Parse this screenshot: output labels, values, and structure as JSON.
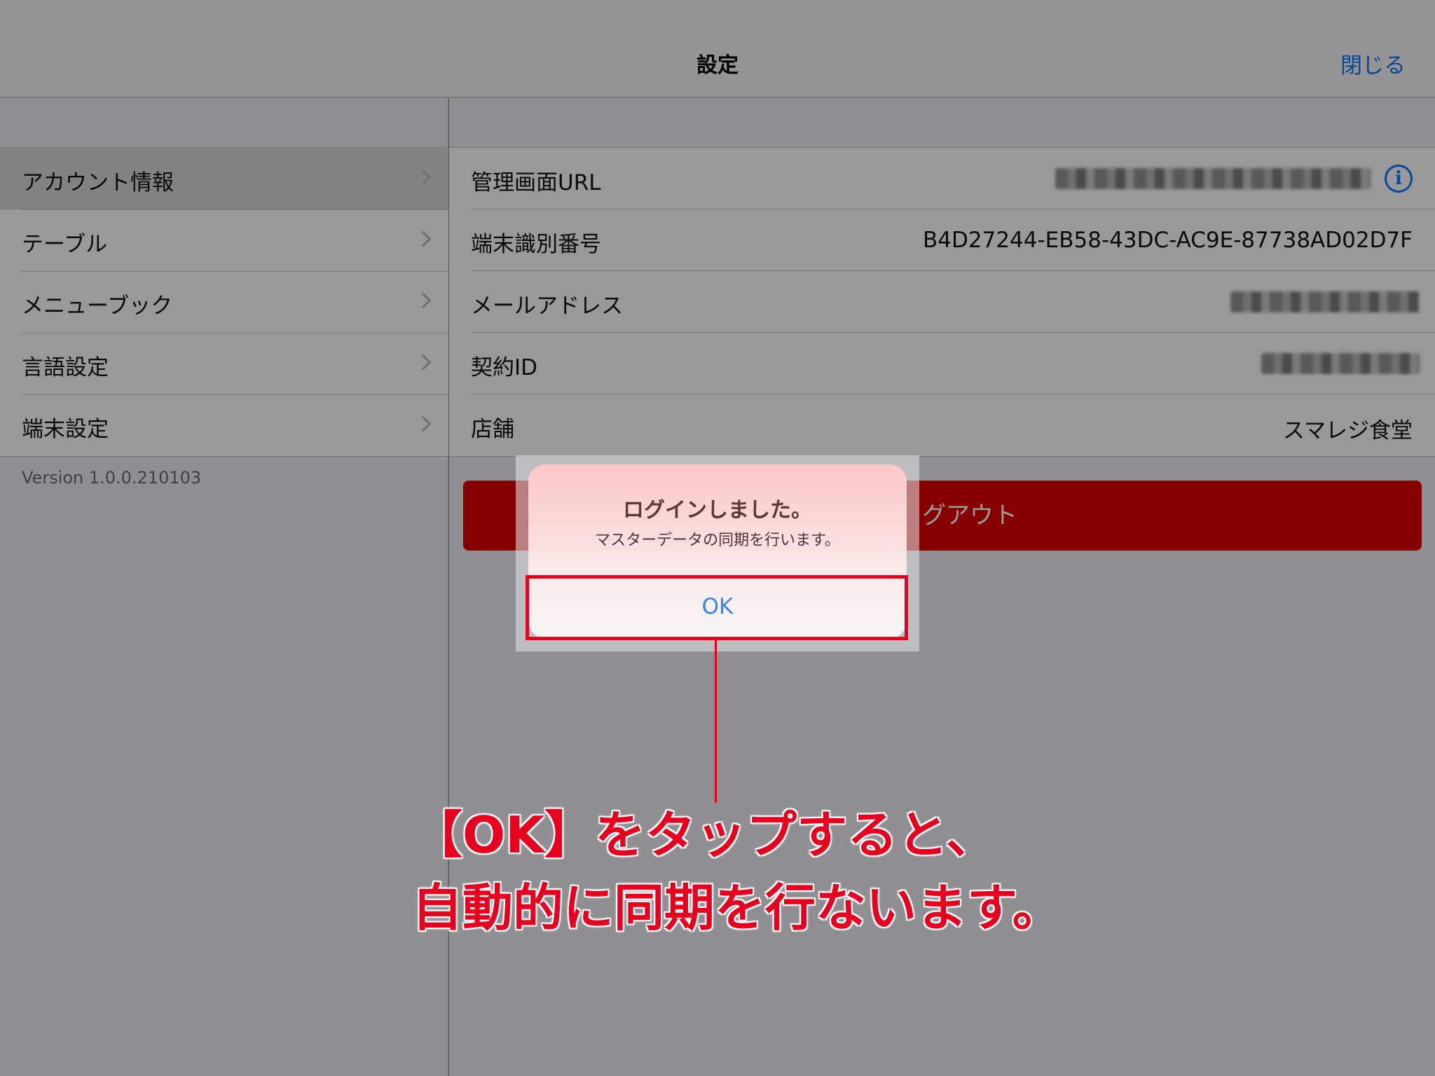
{
  "nav": {
    "title": "設定",
    "close_label": "閉じる"
  },
  "sidebar": {
    "items": [
      {
        "label": "アカウント情報",
        "selected": true
      },
      {
        "label": "テーブル",
        "selected": false
      },
      {
        "label": "メニューブック",
        "selected": false
      },
      {
        "label": "言語設定",
        "selected": false
      },
      {
        "label": "端末設定",
        "selected": false
      }
    ],
    "version": "Version 1.0.0.210103"
  },
  "detail": {
    "rows": [
      {
        "label": "管理画面URL",
        "value": ""
      },
      {
        "label": "端末識別番号",
        "value": "B4D27244-EB58-43DC-AC9E-87738AD02D7F"
      },
      {
        "label": "メールアドレス",
        "value": ""
      },
      {
        "label": "契約ID",
        "value": ""
      },
      {
        "label": "店舗",
        "value": "スマレジ食堂"
      }
    ],
    "logout_label": "グアウト"
  },
  "alert": {
    "title": "ログインしました。",
    "message": "マスターデータの同期を行います。",
    "ok_label": "OK"
  },
  "annotation": {
    "line1": "【OK】をタップすると、",
    "line2": "自動的に同期を行ないます。"
  },
  "colors": {
    "accent": "#0a7aff",
    "annotation": "#e8001f",
    "logout": "#e00000"
  }
}
